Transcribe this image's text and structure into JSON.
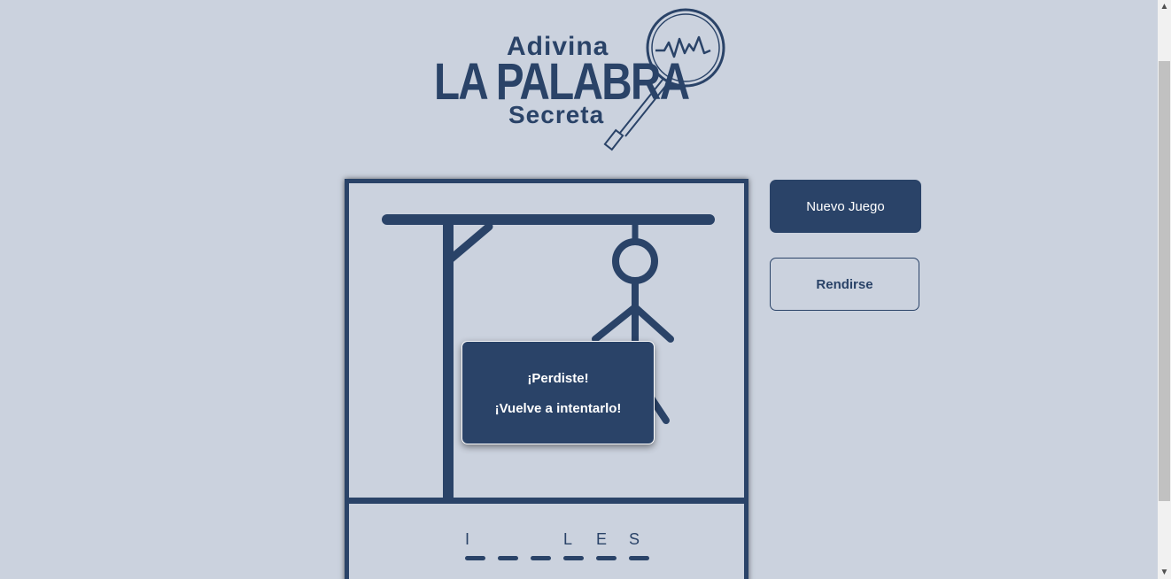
{
  "logo": {
    "line_top": "Adivina",
    "line_main": "LA PALABRA",
    "line_bottom": "Secreta",
    "icon": "magnifying-glass-heartbeat-icon"
  },
  "game": {
    "word_slots": [
      "I",
      "",
      "",
      "L",
      "E",
      "S"
    ],
    "popup": {
      "line1": "¡Perdiste!",
      "line2": "¡Vuelve a intentarlo!"
    }
  },
  "buttons": {
    "new_game": "Nuevo Juego",
    "give_up": "Rendirse"
  },
  "scrollbar": {
    "up_icon": "chevron-up-icon",
    "down_icon": "chevron-down-icon"
  },
  "colors": {
    "primary": "#2a4368",
    "background": "#cbd2de",
    "text_light": "#ffffff"
  }
}
